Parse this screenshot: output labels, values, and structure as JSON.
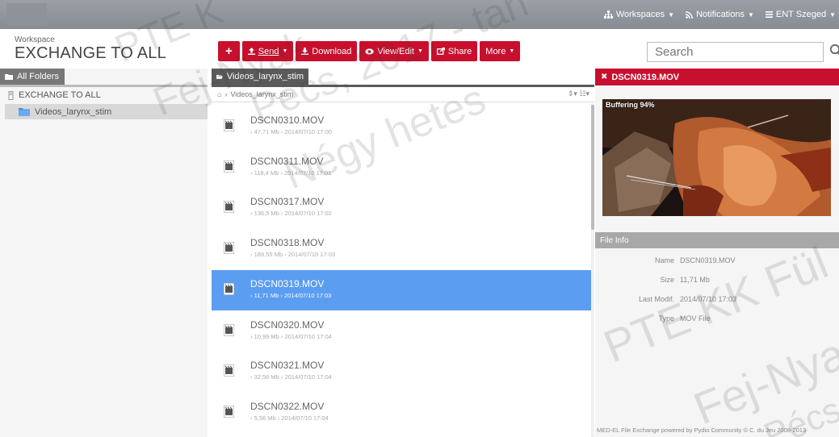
{
  "topnav": [
    {
      "label": "Workspaces",
      "icon": "sitemap-icon"
    },
    {
      "label": "Notifications",
      "icon": "rss-icon"
    },
    {
      "label": "ENT Szeged",
      "icon": "menu-icon"
    }
  ],
  "workspace": {
    "caption": "Workspace",
    "title": "EXCHANGE TO ALL"
  },
  "toolbar": {
    "new_label": "+",
    "send_label": "Send",
    "download_label": "Download",
    "view_label": "View/Edit",
    "share_label": "Share",
    "more_label": "More"
  },
  "search": {
    "placeholder": "Search"
  },
  "left": {
    "tab_label": "All Folders",
    "root_label": "EXCHANGE TO ALL",
    "folder_label": "Videos_larynx_stim"
  },
  "center": {
    "tab_label": "Videos_larynx_stim",
    "path_label": "Videos_larynx_stim",
    "files": [
      {
        "name": "DSCN0310.MOV",
        "meta": "› 47,71 Mb › 2014/07/10 17:00"
      },
      {
        "name": "DSCN0311.MOV",
        "meta": "› 118,4 Mb › 2014/07/10 17:01"
      },
      {
        "name": "DSCN0317.MOV",
        "meta": "› 136,5 Mb › 2014/07/10 17:02"
      },
      {
        "name": "DSCN0318.MOV",
        "meta": "› 169,55 Mb › 2014/07/10 17:03"
      },
      {
        "name": "DSCN0319.MOV",
        "meta": "› 11,71 Mb › 2014/07/10 17:03"
      },
      {
        "name": "DSCN0320.MOV",
        "meta": "› 10,99 Mb › 2014/07/10 17:04"
      },
      {
        "name": "DSCN0321.MOV",
        "meta": "› 32,56 Mb › 2014/07/10 17:04"
      },
      {
        "name": "DSCN0322.MOV",
        "meta": "› 5,56 Mb › 2014/07/10 17:04"
      }
    ],
    "selected_index": 4
  },
  "preview": {
    "title": "DSCN0319.MOV",
    "buffering": "Buffering 94%",
    "buffering_progress": 0.94,
    "info_header": "File Info",
    "info": [
      {
        "label": "Name",
        "value": "DSCN0319.MOV"
      },
      {
        "label": "Size",
        "value": "11,71 Mb"
      },
      {
        "label": "Last Modif.",
        "value": "2014/07/10 17:03"
      },
      {
        "label": "Type",
        "value": "MOV File"
      }
    ]
  },
  "footer": "MED-EL File Exchange powered by Pydio Community © C. du Jeu 2008-2013",
  "watermark": [
    "PTE K",
    "Fej-Nyak",
    "Pécs, 2017 - tan",
    "Négy hetes",
    "PTE KK Fül",
    "Fej-Nya",
    "Pécs"
  ],
  "colors": {
    "accent": "#c8102e",
    "selection": "#5b9df0",
    "topbar": "#8e9399"
  }
}
